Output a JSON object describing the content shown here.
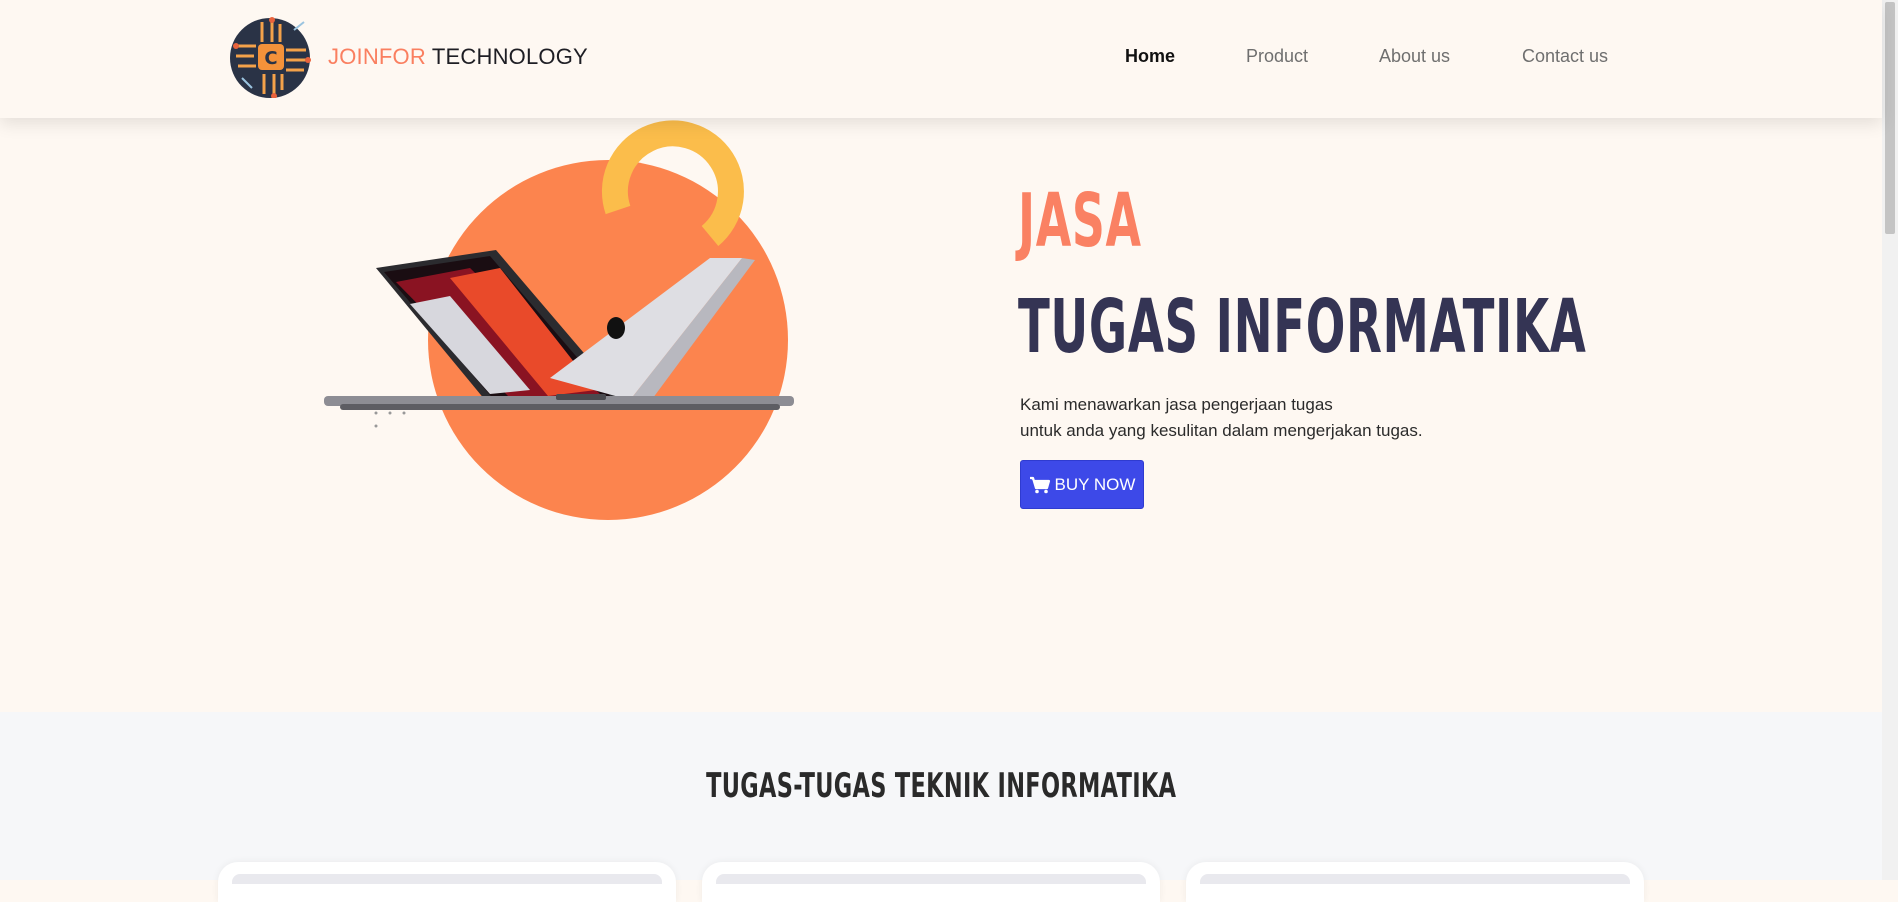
{
  "header": {
    "brand_accent": "JOINFOR",
    "brand_rest": "TECHNOLOGY",
    "nav": [
      "Home",
      "Product",
      "About us",
      "Contact us"
    ],
    "active_nav": "Home"
  },
  "hero": {
    "title_line1": "JASA",
    "title_line2": "TUGAS INFORMATIKA",
    "desc_line1": "Kami menawarkan jasa pengerjaan tugas",
    "desc_line2": "untuk anda yang kesulitan dalam mengerjakan tugas.",
    "button_label": "BUY NOW",
    "button_icon": "cart-icon"
  },
  "section2": {
    "title": "TUGAS-TUGAS TEKNIK INFORMATIKA"
  },
  "colors": {
    "background": "#fef8f2",
    "accent": "#fa7f60",
    "title_dark": "#343454",
    "button": "#3d49e8",
    "circle": "#fc844e",
    "ring": "#fbbd4b"
  }
}
